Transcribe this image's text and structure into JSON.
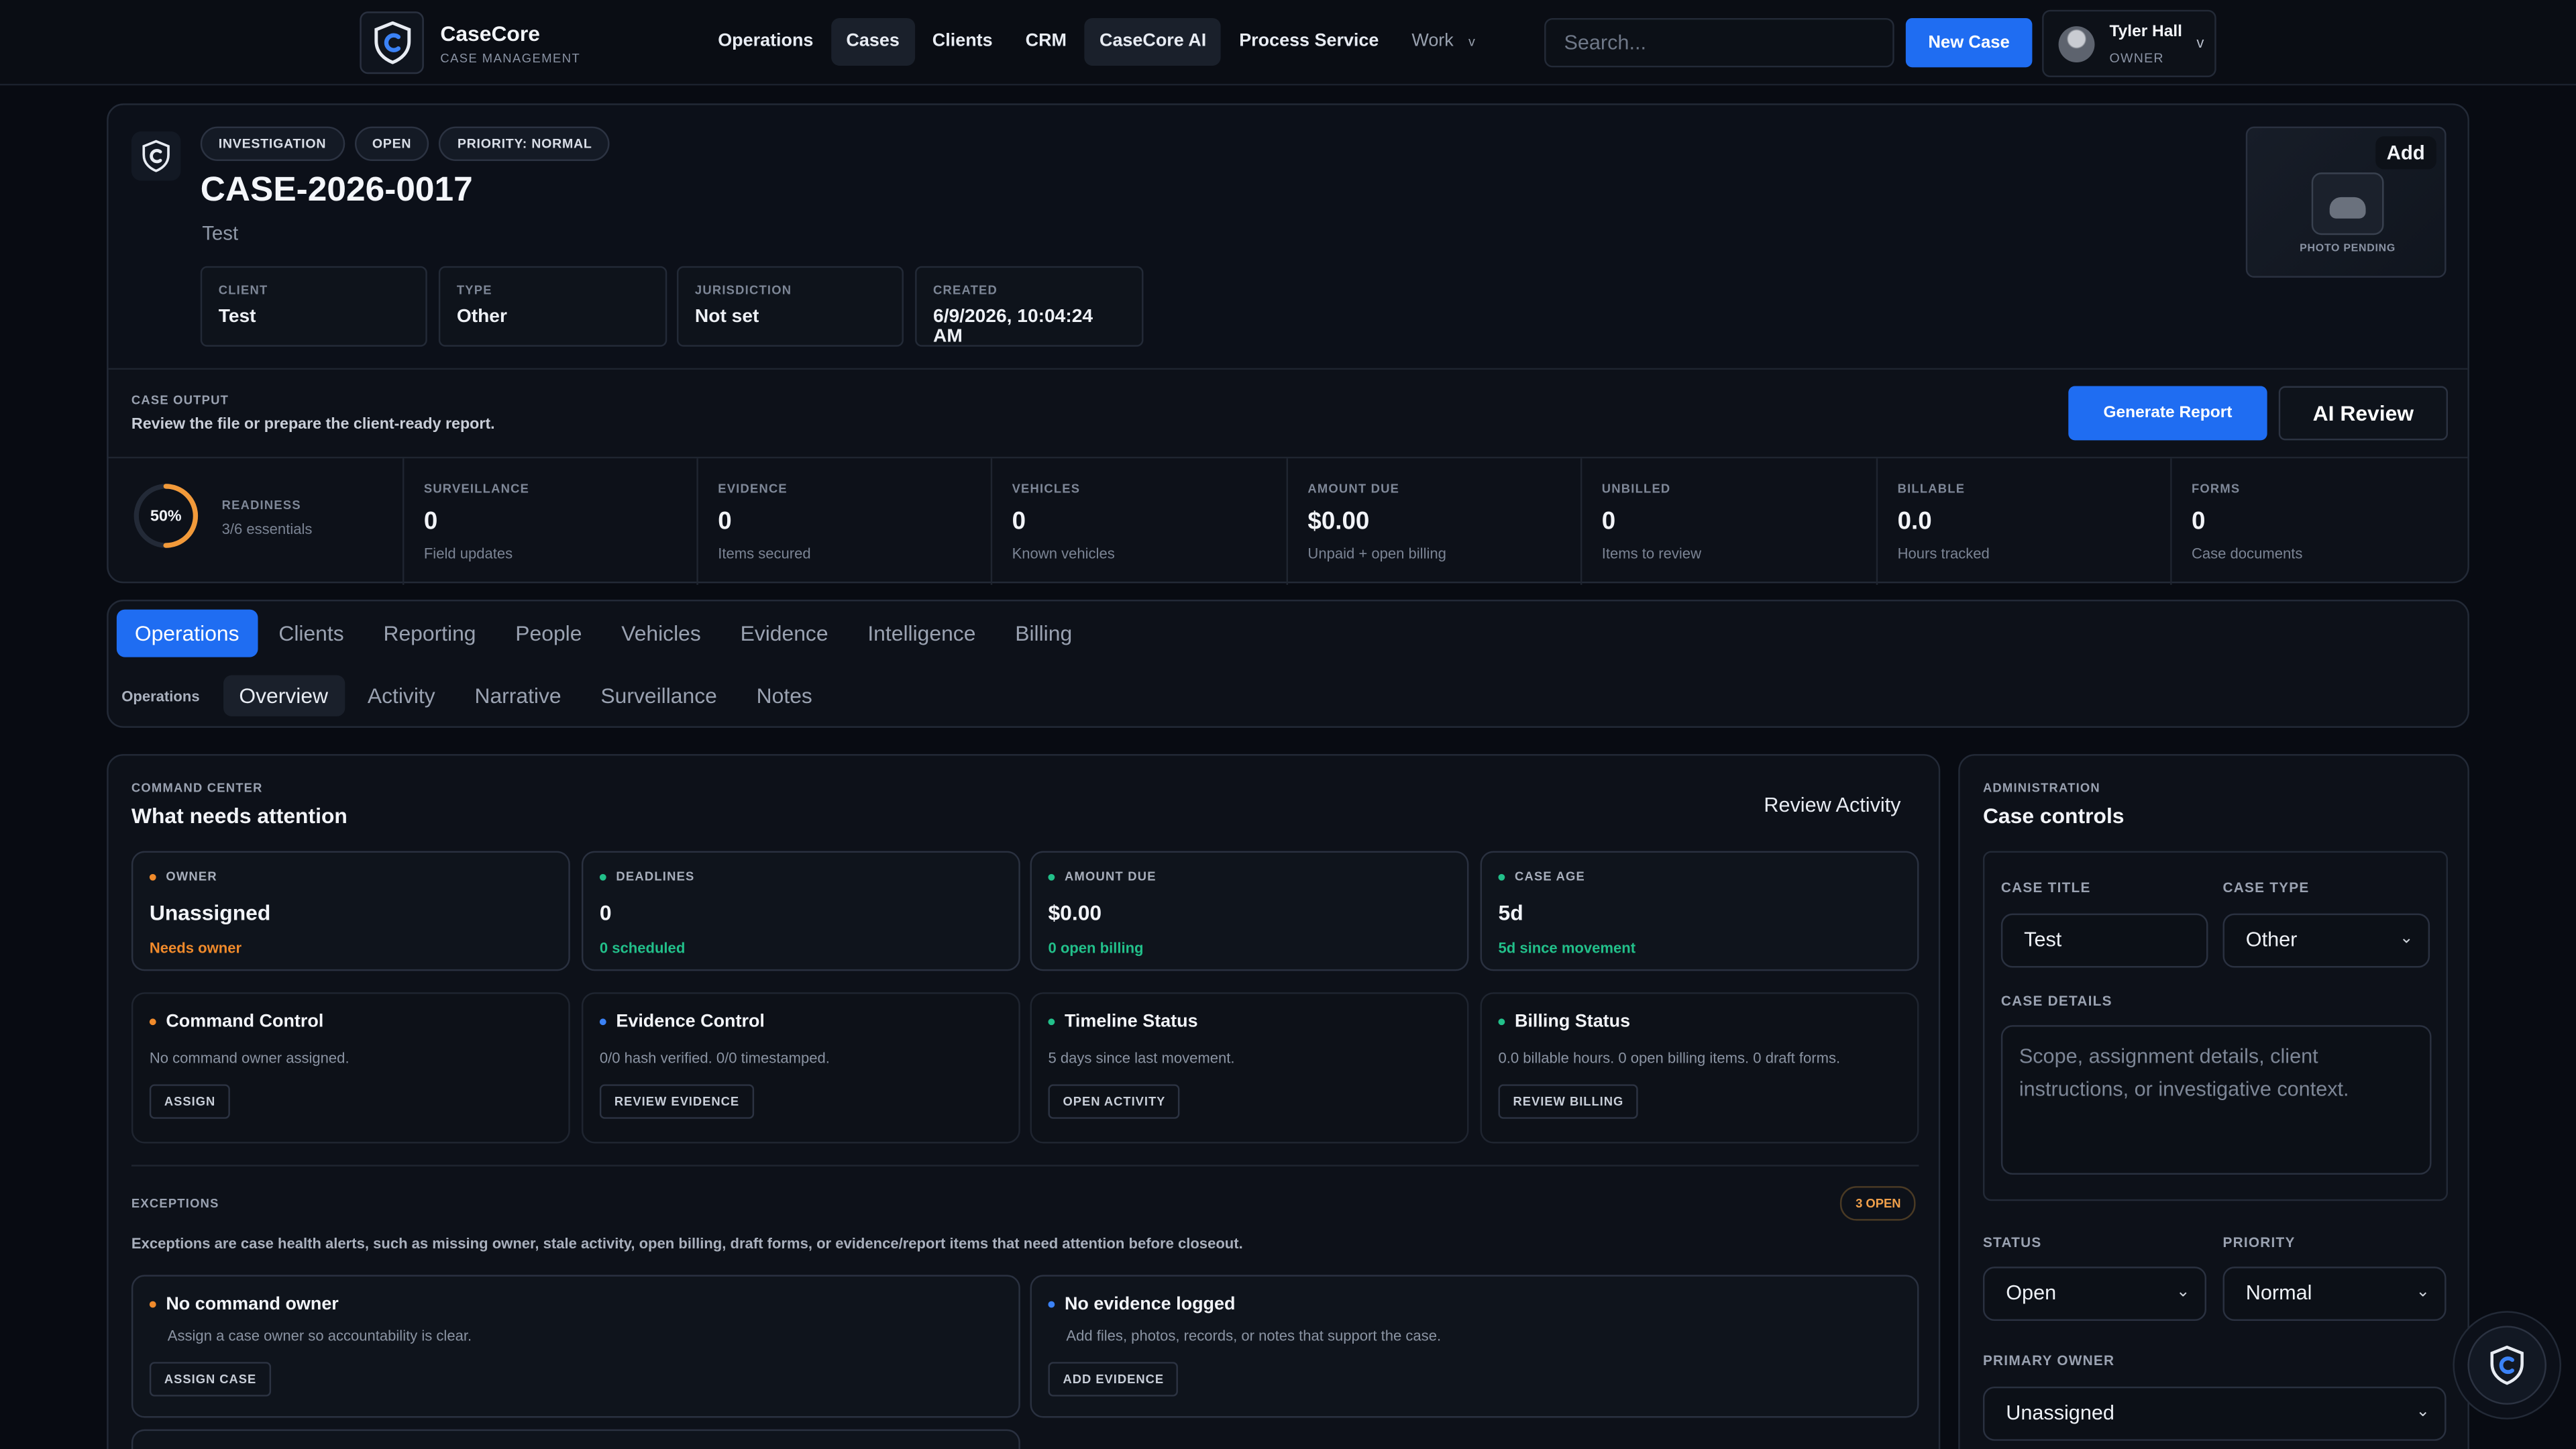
{
  "app": {
    "name": "CaseCore",
    "subtitle": "CASE MANAGEMENT"
  },
  "nav": {
    "items": [
      {
        "label": "Operations"
      },
      {
        "label": "Cases"
      },
      {
        "label": "Clients"
      },
      {
        "label": "CRM"
      },
      {
        "label": "CaseCore AI"
      },
      {
        "label": "Process Service"
      },
      {
        "label": "Work"
      }
    ],
    "work_chevron": "v"
  },
  "search": {
    "placeholder": "Search..."
  },
  "new_case_label": "New Case",
  "user": {
    "name": "Tyler Hall",
    "role": "OWNER",
    "chevron": "v"
  },
  "case": {
    "chips": [
      "INVESTIGATION",
      "OPEN",
      "PRIORITY: NORMAL"
    ],
    "id": "CASE-2026-0017",
    "subtitle": "Test",
    "meta": [
      {
        "label": "CLIENT",
        "value": "Test"
      },
      {
        "label": "TYPE",
        "value": "Other"
      },
      {
        "label": "JURISDICTION",
        "value": "Not set"
      },
      {
        "label": "CREATED",
        "value": "6/9/2026, 10:04:24 AM"
      }
    ],
    "photo": {
      "add_label": "Add",
      "status": "PHOTO PENDING"
    },
    "output": {
      "label": "CASE OUTPUT",
      "desc": "Review the file or prepare the client-ready report."
    },
    "generate_label": "Generate Report",
    "ai_review_label": "AI Review",
    "readiness": {
      "percent": 50,
      "percent_text": "50%",
      "label": "READINESS",
      "sub": "3/6 essentials"
    },
    "stats": [
      {
        "label": "SURVEILLANCE",
        "value": "0",
        "sub": "Field updates"
      },
      {
        "label": "EVIDENCE",
        "value": "0",
        "sub": "Items secured"
      },
      {
        "label": "VEHICLES",
        "value": "0",
        "sub": "Known vehicles"
      },
      {
        "label": "AMOUNT DUE",
        "value": "$0.00",
        "sub": "Unpaid + open billing"
      },
      {
        "label": "UNBILLED",
        "value": "0",
        "sub": "Items to review"
      },
      {
        "label": "BILLABLE",
        "value": "0.0",
        "sub": "Hours tracked"
      },
      {
        "label": "FORMS",
        "value": "0",
        "sub": "Case documents"
      }
    ]
  },
  "tabs": [
    "Operations",
    "Clients",
    "Reporting",
    "People",
    "Vehicles",
    "Evidence",
    "Intelligence",
    "Billing"
  ],
  "subtabs": {
    "label": "Operations",
    "items": [
      "Overview",
      "Activity",
      "Narrative",
      "Surveillance",
      "Notes"
    ]
  },
  "command_center": {
    "label": "COMMAND CENTER",
    "title": "What needs attention",
    "review_label": "Review Activity",
    "summary": [
      {
        "label": "OWNER",
        "value": "Unassigned",
        "status": "Needs owner",
        "color": "#f08a2b"
      },
      {
        "label": "DEADLINES",
        "value": "0",
        "status": "0 scheduled",
        "color": "#22c08a"
      },
      {
        "label": "AMOUNT DUE",
        "value": "$0.00",
        "status": "0 open billing",
        "color": "#22c08a"
      },
      {
        "label": "CASE AGE",
        "value": "5d",
        "status": "5d since movement",
        "color": "#22c08a"
      }
    ],
    "controls": [
      {
        "title": "Command Control",
        "desc": "No command owner assigned.",
        "button": "ASSIGN",
        "color": "#f08a2b"
      },
      {
        "title": "Evidence Control",
        "desc": "0/0 hash verified. 0/0 timestamped.",
        "button": "REVIEW EVIDENCE",
        "color": "#3b82f6"
      },
      {
        "title": "Timeline Status",
        "desc": "5 days since last movement.",
        "button": "OPEN ACTIVITY",
        "color": "#22c08a"
      },
      {
        "title": "Billing Status",
        "desc": "0.0 billable hours. 0 open billing items. 0 draft forms.",
        "button": "REVIEW BILLING",
        "color": "#22c08a"
      }
    ],
    "exceptions": {
      "label": "EXCEPTIONS",
      "count": "3 OPEN",
      "desc": "Exceptions are case health alerts, such as missing owner, stale activity, open billing, draft forms, or evidence/report items that need attention before closeout.",
      "items": [
        {
          "title": "No command owner",
          "desc": "Assign a case owner so accountability is clear.",
          "button": "ASSIGN CASE",
          "color": "#f08a2b"
        },
        {
          "title": "No evidence logged",
          "desc": "Add files, photos, records, or notes that support the case.",
          "button": "ADD EVIDENCE",
          "color": "#3b82f6"
        }
      ]
    }
  },
  "admin": {
    "label": "ADMINISTRATION",
    "title": "Case controls",
    "case_title_label": "CASE TITLE",
    "case_title_value": "Test",
    "case_type_label": "CASE TYPE",
    "case_type_value": "Other",
    "case_details_label": "CASE DETAILS",
    "case_details_placeholder": "Scope, assignment details, client instructions, or investigative context.",
    "status_label": "STATUS",
    "status_value": "Open",
    "priority_label": "PRIORITY",
    "priority_value": "Normal",
    "owner_label": "PRIMARY OWNER",
    "owner_value": "Unassigned"
  },
  "colors": {
    "accent": "#1f6df2",
    "warning": "#f08a2b",
    "ok": "#22c08a",
    "info": "#3b82f6",
    "ring": "#f29a3a"
  }
}
